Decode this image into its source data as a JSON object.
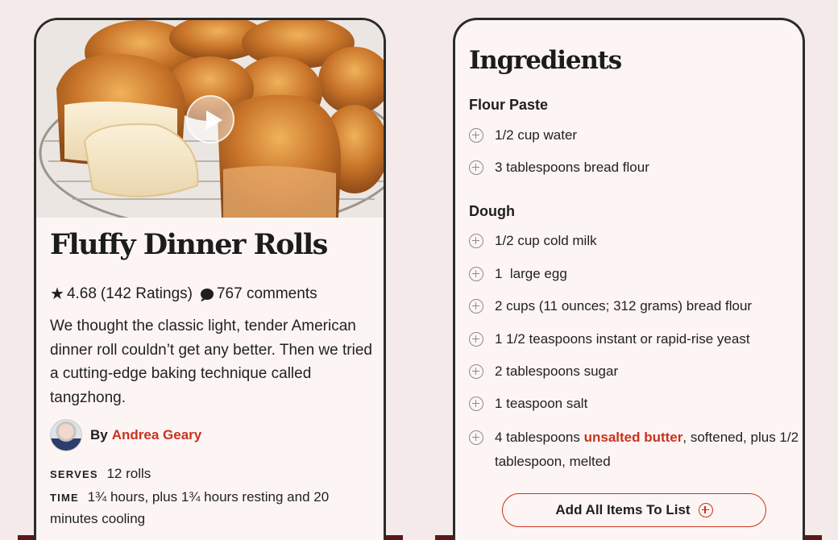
{
  "recipe": {
    "title": "Fluffy Dinner Rolls",
    "rating": "4.68",
    "ratings_count": "(142 Ratings)",
    "comments": "767 comments",
    "description": "We thought the classic light, tender American dinner roll couldn’t get any better. Then we tried a cutting-edge baking technique called tangzhong.",
    "by_label": "By",
    "author": "Andrea Geary",
    "serves_label": "SERVES",
    "serves": "12 rolls",
    "time_label": "TIME",
    "time": "1¾ hours, plus 1¾ hours resting and 20 minutes cooling"
  },
  "ingredients": {
    "title": "Ingredients",
    "sections": [
      {
        "name": "Flour Paste",
        "items": [
          "1/2 cup water",
          "3 tablespoons bread flour"
        ]
      },
      {
        "name": "Dough",
        "items": [
          "1/2 cup cold milk",
          "1  large egg",
          "2 cups (11 ounces; 312 grams) bread flour",
          "1 1/2 teaspoons instant or rapid-rise yeast",
          "2 tablespoons sugar",
          "1 teaspoon salt"
        ]
      }
    ],
    "butter_item": {
      "prefix": "4 tablespoons ",
      "link": "unsalted butter",
      "suffix": ", softened, plus 1/2 tablespoon, melted"
    },
    "add_all_label": "Add All Items To List"
  },
  "icons": {
    "star": "star-icon",
    "comment": "comment-icon",
    "play": "play-icon",
    "plus": "plus-circle-icon"
  },
  "colors": {
    "accent": "#c9321e",
    "background": "#f5eaea",
    "card": "#fdf5f4",
    "bottom_bar": "#5a1818"
  }
}
